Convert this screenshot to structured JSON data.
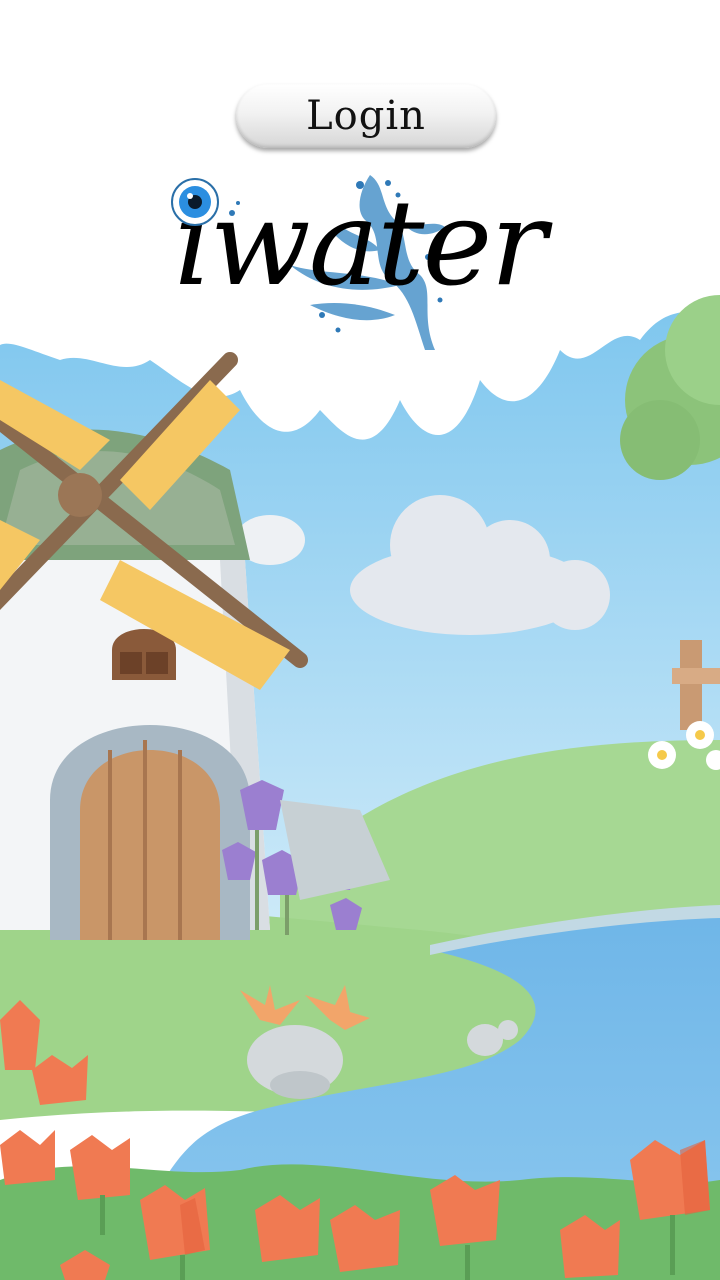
{
  "header": {
    "login_label": "Login"
  },
  "logo": {
    "text": "iwater",
    "icon": "eye-icon"
  },
  "background": {
    "scene": "windmill-landscape",
    "sky": "#a9d8f0",
    "grass": "#9fd48a",
    "water": "#7fbde6"
  }
}
